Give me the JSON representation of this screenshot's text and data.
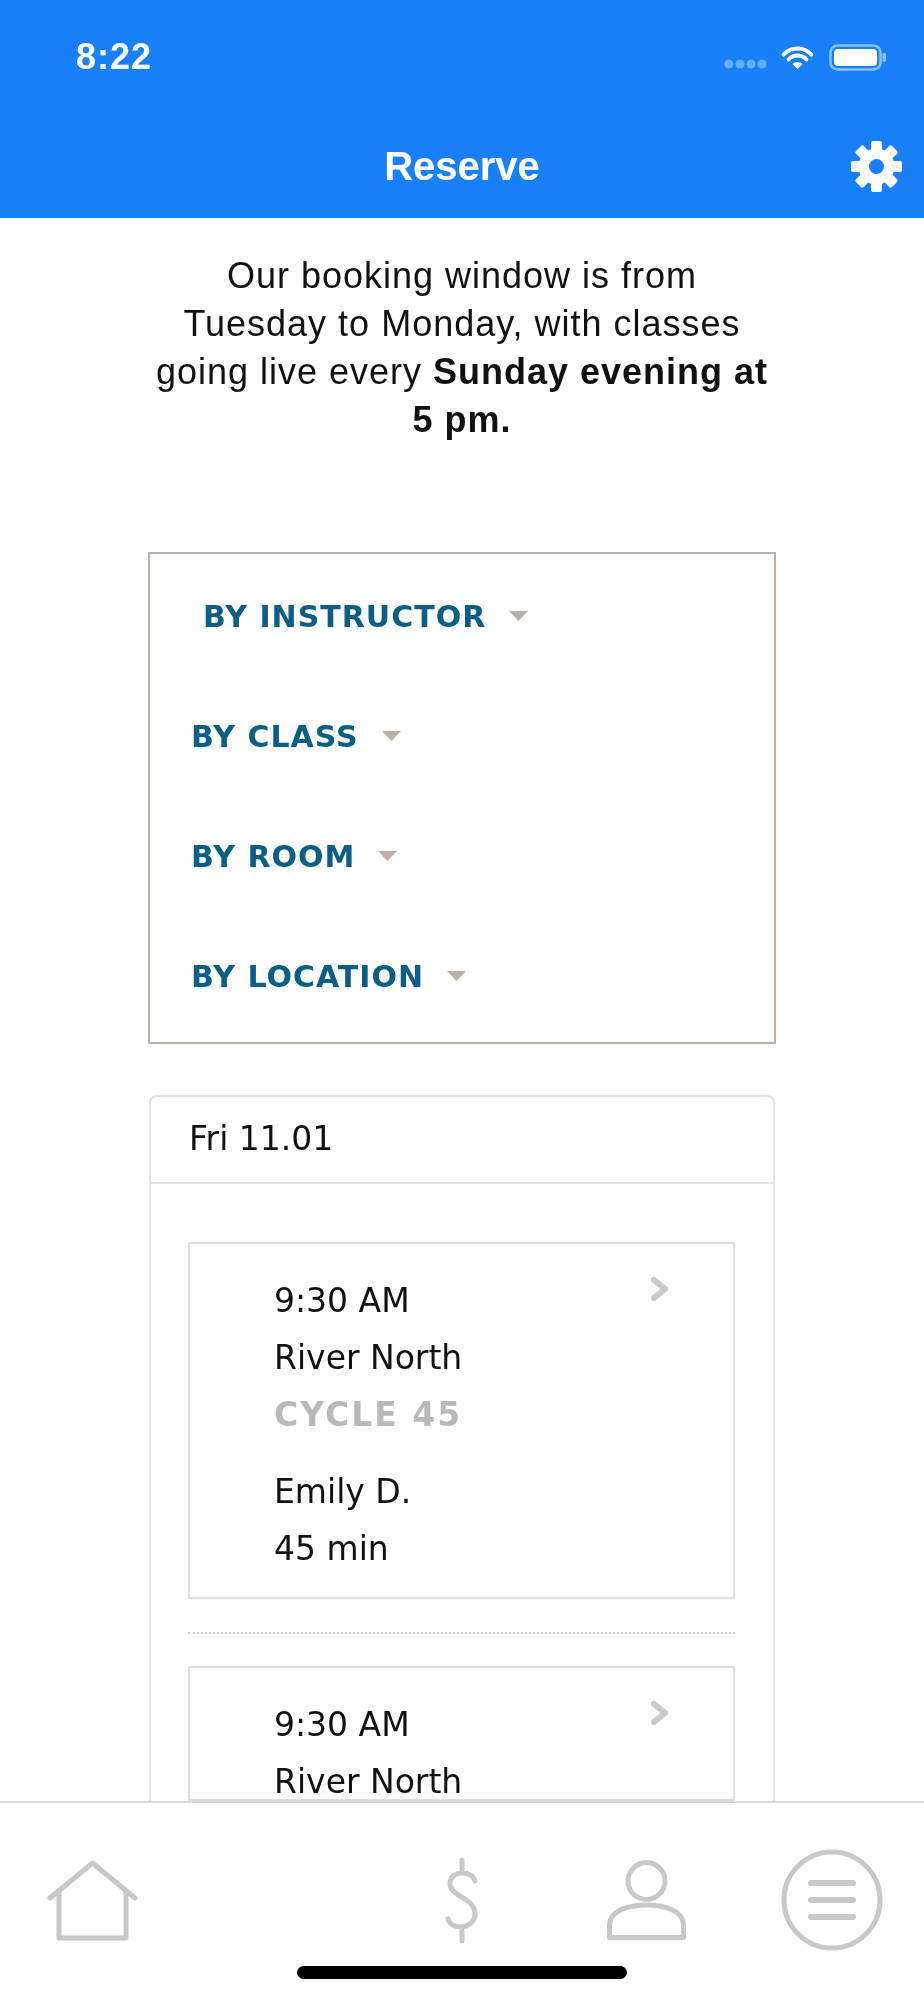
{
  "status_bar": {
    "time": "8:22"
  },
  "header": {
    "title": "Reserve"
  },
  "intro": "Our booking window is from Tuesday to Monday, with classes going live every **Sunday evening at 5 pm.**",
  "filters": [
    "BY INSTRUCTOR",
    "BY CLASS",
    "BY ROOM",
    "BY LOCATION"
  ],
  "schedule": {
    "date": "Fri 11.01",
    "classes": [
      {
        "time": "9:30 AM",
        "location": "River North",
        "class_name": "CYCLE 45",
        "instructor": "Emily D.",
        "duration": "45 min"
      },
      {
        "time": "9:30 AM",
        "location": "River North"
      }
    ]
  }
}
